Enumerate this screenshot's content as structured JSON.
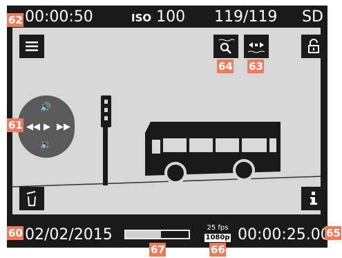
{
  "top": {
    "timer": "00:00:50",
    "iso_label": "ISO",
    "iso_value": "100",
    "frames": "119/119",
    "card": "SD"
  },
  "bottom": {
    "date": "02/02/2015",
    "progress_fraction": 0.56,
    "fps": "25 fps",
    "resolution": "1080p",
    "elapsed": "00:00:25.00"
  },
  "callouts": {
    "c60": "60",
    "c61": "61",
    "c62": "62",
    "c63": "63",
    "c64": "64",
    "c65": "65",
    "c66": "66",
    "c67": "67"
  },
  "icons": {
    "menu": "menu-icon",
    "zoom": "magnifier-icon",
    "frame_step": "frame-step-icon",
    "lock": "lock-icon",
    "delete": "trash-icon",
    "info": "info-icon"
  },
  "colors": {
    "screen_bg": "#1a1a1a",
    "viewport_bg": "#d7d7d7",
    "callout": "#f07a5b"
  }
}
